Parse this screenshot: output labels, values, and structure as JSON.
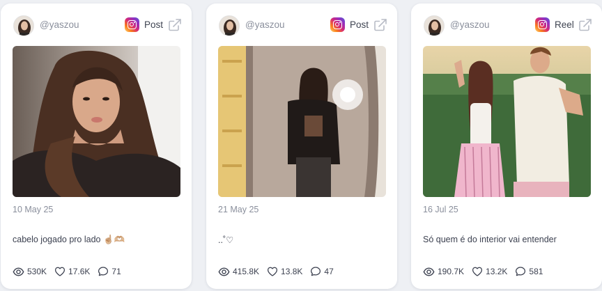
{
  "colors": {
    "card_bg": "#ffffff",
    "page_bg": "#eef0f4",
    "muted_text": "#8a8f9c"
  },
  "posts": [
    {
      "handle": "@yaszou",
      "type": "Post",
      "date": "10 May 25",
      "caption": "cabelo jogado pro lado ☝🏼🫶🏼",
      "views": "530K",
      "likes": "17.6K",
      "comments": "71"
    },
    {
      "handle": "@yaszou",
      "type": "Post",
      "date": "21 May 25",
      "caption": "..˚♡",
      "views": "415.8K",
      "likes": "13.8K",
      "comments": "47"
    },
    {
      "handle": "@yaszou",
      "type": "Reel",
      "date": "16 Jul 25",
      "caption": "Só quem é do interior vai entender",
      "views": "190.7K",
      "likes": "13.2K",
      "comments": "581"
    }
  ]
}
